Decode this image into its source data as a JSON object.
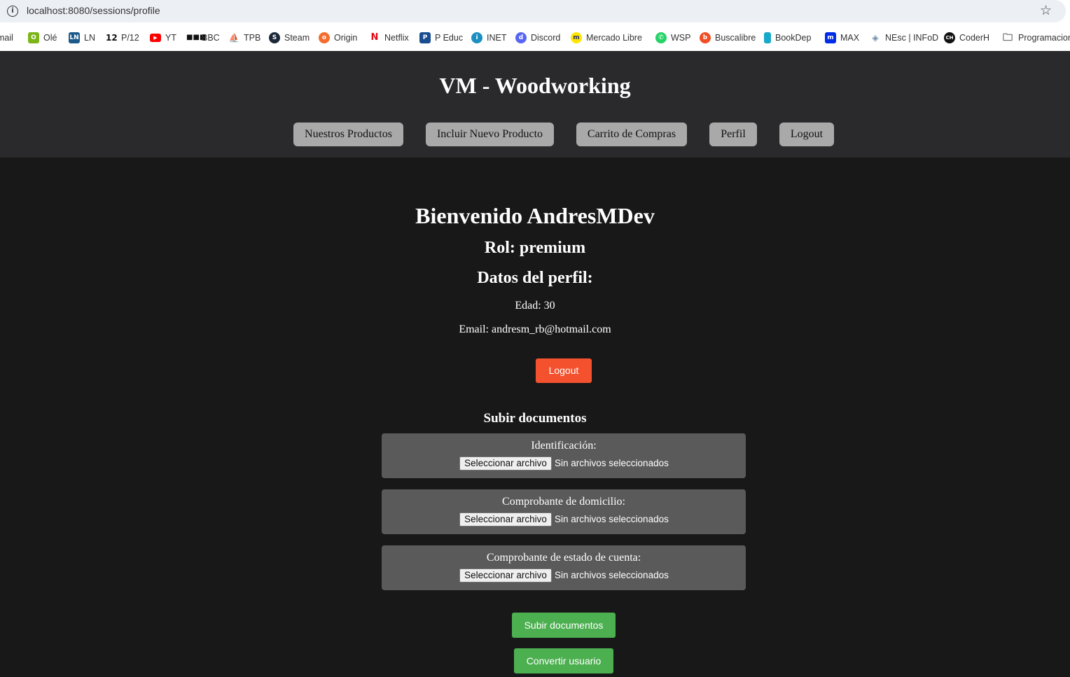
{
  "browser": {
    "url": "localhost:8080/sessions/profile",
    "bookmarks": [
      {
        "label": "mail",
        "icon": "gmail-icon",
        "color": "#ffffff"
      },
      {
        "label": "Olé",
        "icon": "ole-icon",
        "color": "#7cb518"
      },
      {
        "label": "LN",
        "icon": "ln-icon",
        "color": "#1c5a8a"
      },
      {
        "label": "P/12",
        "icon": "p12-icon",
        "color": "#111111"
      },
      {
        "label": "YT",
        "icon": "youtube-icon",
        "color": "#ff0000"
      },
      {
        "label": "BBC",
        "icon": "bbc-icon",
        "color": "#111111"
      },
      {
        "label": "TPB",
        "icon": "tpb-icon",
        "color": "#444444"
      },
      {
        "label": "Steam",
        "icon": "steam-icon",
        "color": "#1b2838"
      },
      {
        "label": "Origin",
        "icon": "origin-icon",
        "color": "#f56c2d"
      },
      {
        "label": "Netflix",
        "icon": "netflix-icon",
        "color": "#e50914"
      },
      {
        "label": "P Educ",
        "icon": "peduc-icon",
        "color": "#1a4d8f"
      },
      {
        "label": "INET",
        "icon": "inet-icon",
        "color": "#1b8fc1"
      },
      {
        "label": "Discord",
        "icon": "discord-icon",
        "color": "#5865f2"
      },
      {
        "label": "Mercado Libre",
        "icon": "mercadolibre-icon",
        "color": "#ffe600"
      },
      {
        "label": "WSP",
        "icon": "whatsapp-icon",
        "color": "#25d366"
      },
      {
        "label": "Buscalibre",
        "icon": "buscalibre-icon",
        "color": "#f04e23"
      },
      {
        "label": "BookDep",
        "icon": "bookdep-icon",
        "color": "#17a9c9"
      },
      {
        "label": "MAX",
        "icon": "max-icon",
        "color": "#002be7"
      },
      {
        "label": "NEsc | INFoD",
        "icon": "infod-icon",
        "color": "#6b8aa8"
      },
      {
        "label": "CoderH",
        "icon": "coderh-icon",
        "color": "#111111"
      },
      {
        "label": "Programacion",
        "icon": "folder-icon",
        "color": "#444444"
      }
    ]
  },
  "header": {
    "title": "VM - Woodworking",
    "nav": [
      "Nuestros Productos",
      "Incluir Nuevo Producto",
      "Carrito de Compras",
      "Perfil",
      "Logout"
    ]
  },
  "profile": {
    "welcome": "Bienvenido AndresMDev",
    "rol": "Rol: premium",
    "datos_heading": "Datos del perfil:",
    "edad": "Edad: 30",
    "email": "Email: andresm_rb@hotmail.com",
    "logout_label": "Logout"
  },
  "documents": {
    "heading": "Subir documentos",
    "items": [
      {
        "label": "Identificación:",
        "button": "Seleccionar archivo",
        "status": "Sin archivos seleccionados"
      },
      {
        "label": "Comprobante de domicilio:",
        "button": "Seleccionar archivo",
        "status": "Sin archivos seleccionados"
      },
      {
        "label": "Comprobante de estado de cuenta:",
        "button": "Seleccionar archivo",
        "status": "Sin archivos seleccionados"
      }
    ],
    "submit_label": "Subir documentos",
    "convert_label": "Convertir usuario"
  },
  "colors": {
    "header_bg": "#2a2a2c",
    "page_bg": "#181818",
    "nav_button": "#a9a9a9",
    "logout_button": "#f4522f",
    "doc_box": "#5b5a5a",
    "green_button": "#4caf50"
  }
}
